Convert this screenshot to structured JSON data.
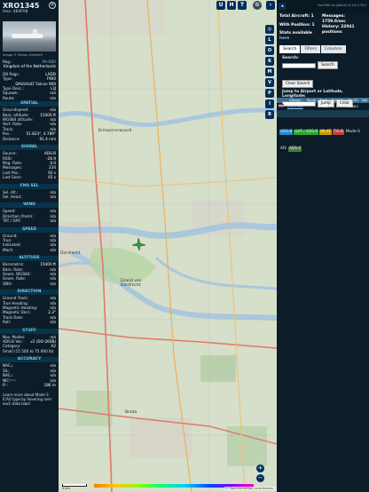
{
  "left": {
    "callsign": "XRO1345",
    "hex_line": "Hex: 484FA8",
    "photo_credit": "Image © Fabian Zimmerli",
    "top_rows": [
      {
        "k": "Reg.:",
        "v": "PH-EBR",
        "link": true
      },
      {
        "k": "",
        "v": "Kingdom of the Netherlands",
        "link": false
      }
    ],
    "db_rows": [
      {
        "k": "DB flags:",
        "v": "LADD"
      },
      {
        "k": "Type:",
        "v": "F900"
      },
      {
        "k": "",
        "v": "DASSAULT Falcon 900"
      },
      {
        "k": "Type Desc.:",
        "v": "L3J"
      },
      {
        "k": "Squawk:",
        "v": "n/a"
      },
      {
        "k": "Route:",
        "v": "n/a"
      }
    ],
    "sections": [
      {
        "title": "SPATIAL",
        "rows": [
          {
            "k": "Groundspeed:",
            "v": "n/a"
          },
          {
            "k": "Baro. altitude:",
            "v": "15400 ft"
          },
          {
            "k": "WGS84 altitude:",
            "v": "n/a"
          },
          {
            "k": "Vert. Rate:",
            "v": "n/a"
          },
          {
            "k": "Track:",
            "v": "n/a"
          },
          {
            "k": "Pos.:",
            "v": "51.823°, 4.789°"
          },
          {
            "k": "Distance:",
            "v": "91.4 nmi"
          }
        ]
      },
      {
        "title": "SIGNAL",
        "rows": [
          {
            "k": "Source:",
            "v": "ADS-B"
          },
          {
            "k": "RSSI:",
            "v": "-26.9"
          },
          {
            "k": "Msg. Rate:",
            "v": "0.0"
          },
          {
            "k": "Messages:",
            "v": "234"
          },
          {
            "k": "",
            "v": ""
          },
          {
            "k": "Last Pos.:",
            "v": "92 s"
          },
          {
            "k": "Last Seen:",
            "v": "65 s"
          }
        ]
      },
      {
        "title": "FMS SEL",
        "rows": [
          {
            "k": "Sel. Alt.:",
            "v": "n/a"
          },
          {
            "k": "Sel. Head.:",
            "v": "n/a"
          }
        ]
      },
      {
        "title": "WIND",
        "rows": [
          {
            "k": "Speed:",
            "v": "n/a"
          },
          {
            "k": "Direction (from):",
            "v": "n/a"
          },
          {
            "k": "TAT / OAT:",
            "v": "n/a"
          }
        ]
      },
      {
        "title": "SPEED",
        "rows": [
          {
            "k": "Ground:",
            "v": "n/a"
          },
          {
            "k": "True:",
            "v": "n/a"
          },
          {
            "k": "Indicated:",
            "v": "n/a"
          },
          {
            "k": "Mach:",
            "v": "n/a"
          }
        ]
      },
      {
        "title": "ALTITUDE",
        "rows": [
          {
            "k": "Barometric:",
            "v": "15400 ft"
          },
          {
            "k": "Baro. Rate:",
            "v": "n/a"
          },
          {
            "k": "Geom. WGS84:",
            "v": "n/a"
          },
          {
            "k": "Geom. Rate:",
            "v": "n/a"
          },
          {
            "k": "QNH:",
            "v": "n/a"
          }
        ]
      },
      {
        "title": "DIRECTION",
        "rows": [
          {
            "k": "Ground Track:",
            "v": "n/a"
          },
          {
            "k": "True Heading:",
            "v": "n/a"
          },
          {
            "k": "Magnetic Heading:",
            "v": "n/a"
          },
          {
            "k": "Magnetic Decl.:",
            "v": "2.3°"
          },
          {
            "k": "Track Rate:",
            "v": "n/a"
          },
          {
            "k": "Roll:",
            "v": "n/a"
          }
        ]
      },
      {
        "title": "STUFF",
        "rows": [
          {
            "k": "Nav. Modes:",
            "v": "n/a"
          },
          {
            "k": "ADS-B Ver.:",
            "v": "v2 (DO-260B)"
          },
          {
            "k": "Category:",
            "v": "A2"
          },
          {
            "k": "Small (15 500 to 75 000 lb)",
            "v": ""
          }
        ]
      },
      {
        "title": "ACCURACY",
        "rows": [
          {
            "k": "NACₚ:",
            "v": "n/a"
          },
          {
            "k": "SIL:",
            "v": "n/a"
          },
          {
            "k": "NACᵥ:",
            "v": "n/a"
          },
          {
            "k": "NICᵇᵃʳᵒ:",
            "v": "n/a"
          },
          {
            "k": "Rᶜ:",
            "v": "186 m"
          }
        ]
      }
    ],
    "footer": "Learn more about Mode S ICAO type by hovering over each data label"
  },
  "map": {
    "towns": [
      {
        "name": "Krimpenerwaard",
        "pos": "t1"
      },
      {
        "name": "Dordrecht",
        "pos": "t2"
      },
      {
        "name": "Eiland van Dordrecht",
        "pos": "t3"
      },
      {
        "name": "Breda",
        "pos": "t4"
      }
    ],
    "top_buttons": [
      "U",
      "H",
      "T"
    ],
    "side_buttons": [
      "L",
      "O",
      "K",
      "M",
      "V",
      "P",
      "I",
      "R"
    ],
    "scale_label": "5 km",
    "attribution": "© OpenStreetMap contributors."
  },
  "right": {
    "version_link": "tar1090 on github (3.14.1702)",
    "stats": {
      "total_label": "Total Aircraft: 1",
      "messages_label": "Messages:",
      "messages_value": "1759.0/sec",
      "with_pos_label": "With Position: 1",
      "history_label": "History: 22041 positions",
      "stats_label": "Stats available",
      "stats_link": "here"
    },
    "tabs": [
      "Search",
      "Filters",
      "Columns"
    ],
    "search_label": "Search:",
    "search_button": "Search",
    "clear_search_button": "Clear Search",
    "jump_label": "Jump to Airport or Latitude, Longitude:",
    "jump_button": "Jump",
    "clear_button": "Clear",
    "table_headers": [
      "",
      "Callsign",
      "Route",
      "Type",
      "Squawk",
      "Alt. (ft)",
      "Spd"
    ],
    "table_rows": [
      {
        "callsign": "XRO1345",
        "route": "",
        "type": "F900",
        "squawk": "",
        "alt": "15400",
        "spd": ""
      }
    ],
    "badges": [
      {
        "label": "ADS-B",
        "color": "#1f8bc9"
      },
      {
        "label": "UAT / ADS-R",
        "color": "#2da52d"
      },
      {
        "label": "MLAT",
        "color": "#c79b00"
      },
      {
        "label": "TIS-B",
        "color": "#c23b3b"
      },
      {
        "label": "Mode-S",
        "color": "transparent"
      },
      {
        "label": "AIS",
        "color": "transparent"
      },
      {
        "label": "ADS-C",
        "color": "#4a7a3a"
      }
    ]
  }
}
